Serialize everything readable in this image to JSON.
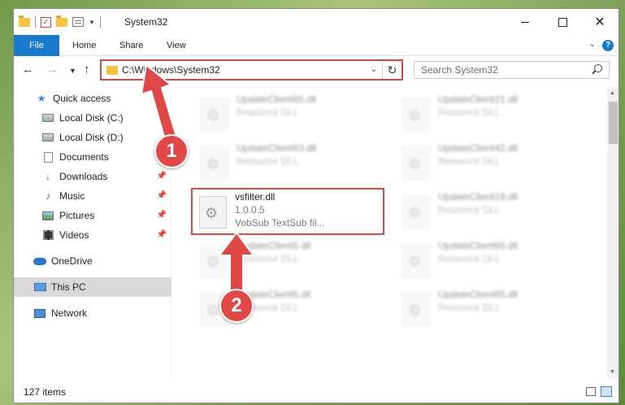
{
  "window": {
    "title": "System32",
    "controls": {
      "minimize": "minimize-icon",
      "maximize": "maximize-icon",
      "close": "✕"
    }
  },
  "ribbon": {
    "tabs": [
      "File",
      "Home",
      "Share",
      "View"
    ],
    "help": "?"
  },
  "navigation": {
    "address_path": "C:\\Windows\\System32",
    "search_placeholder": "Search System32"
  },
  "sidebar": {
    "items": [
      {
        "label": "Quick access",
        "icon": "star-icon",
        "pinned": false
      },
      {
        "label": "Local Disk (C:)",
        "icon": "drive-icon",
        "pinned": false
      },
      {
        "label": "Local Disk (D:)",
        "icon": "drive-icon",
        "pinned": false
      },
      {
        "label": "Documents",
        "icon": "documents-icon",
        "pinned": false
      },
      {
        "label": "Downloads",
        "icon": "downloads-icon",
        "pinned": true
      },
      {
        "label": "Music",
        "icon": "music-icon",
        "pinned": true
      },
      {
        "label": "Pictures",
        "icon": "pictures-icon",
        "pinned": true
      },
      {
        "label": "Videos",
        "icon": "videos-icon",
        "pinned": true
      },
      {
        "label": "OneDrive",
        "icon": "onedrive-icon",
        "pinned": false
      },
      {
        "label": "This PC",
        "icon": "this-pc-icon",
        "pinned": false,
        "selected": true
      },
      {
        "label": "Network",
        "icon": "network-icon",
        "pinned": false
      }
    ]
  },
  "files": [
    {
      "name": "UpdateClient65.dll",
      "type": "Resource DLL",
      "blurred": true
    },
    {
      "name": "UpdateClient21.dll",
      "type": "Resource DLL",
      "blurred": true
    },
    {
      "name": "UpdateClient63.dll",
      "type": "Resource DLL",
      "blurred": true
    },
    {
      "name": "UpdateClient42.dll",
      "type": "Resource DLL",
      "blurred": true
    },
    {
      "name": "vsfilter.dll",
      "version": "1.0.0.5",
      "description": "VobSub  TextSub fil...",
      "blurred": false,
      "highlighted": true
    },
    {
      "name": "UpdateClient19.dll",
      "type": "Resource DLL",
      "blurred": true
    },
    {
      "name": "UpdateClient5.dll",
      "type": "Resource DLL",
      "blurred": true
    },
    {
      "name": "UpdateClient65.dll",
      "type": "Resource DLL",
      "blurred": true
    },
    {
      "name": "UpdateClient5.dll",
      "type": "Resource DLL",
      "blurred": true
    },
    {
      "name": "UpdateClient65.dll",
      "type": "Resource DLL",
      "blurred": true
    }
  ],
  "status": {
    "item_count": "127 items"
  },
  "callouts": {
    "step1": "1",
    "step2": "2",
    "accent": "#e04848"
  }
}
